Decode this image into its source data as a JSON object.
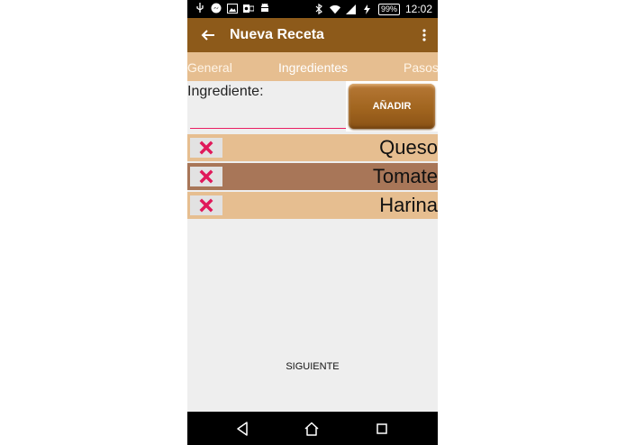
{
  "status_bar": {
    "left_icons": [
      "usb-icon",
      "messenger-icon",
      "image-icon",
      "outlook-icon",
      "android-icon"
    ],
    "right_icons": [
      "bluetooth-icon",
      "wifi-icon",
      "signal-icon",
      "battery-icon"
    ],
    "battery_level": "99%",
    "time": "12:02"
  },
  "appbar": {
    "title": "Nueva Receta",
    "color": "#8d5a1a"
  },
  "tabs": [
    {
      "label": "General",
      "selected": false
    },
    {
      "label": "Ingredientes",
      "selected": true
    },
    {
      "label": "Pasos",
      "selected": false
    }
  ],
  "form": {
    "label": "Ingrediente:",
    "value": "",
    "placeholder": "",
    "add_button_label": "AÑADIR"
  },
  "ingredients": [
    {
      "name": "Queso"
    },
    {
      "name": "Tomate"
    },
    {
      "name": "Harina"
    }
  ],
  "footer": {
    "next_label": "SIGUIENTE"
  },
  "colors": {
    "row_light": "#e6be90",
    "row_selected": "#a87658",
    "delete_icon": "#e0195a",
    "input_underline": "#e91e63"
  }
}
